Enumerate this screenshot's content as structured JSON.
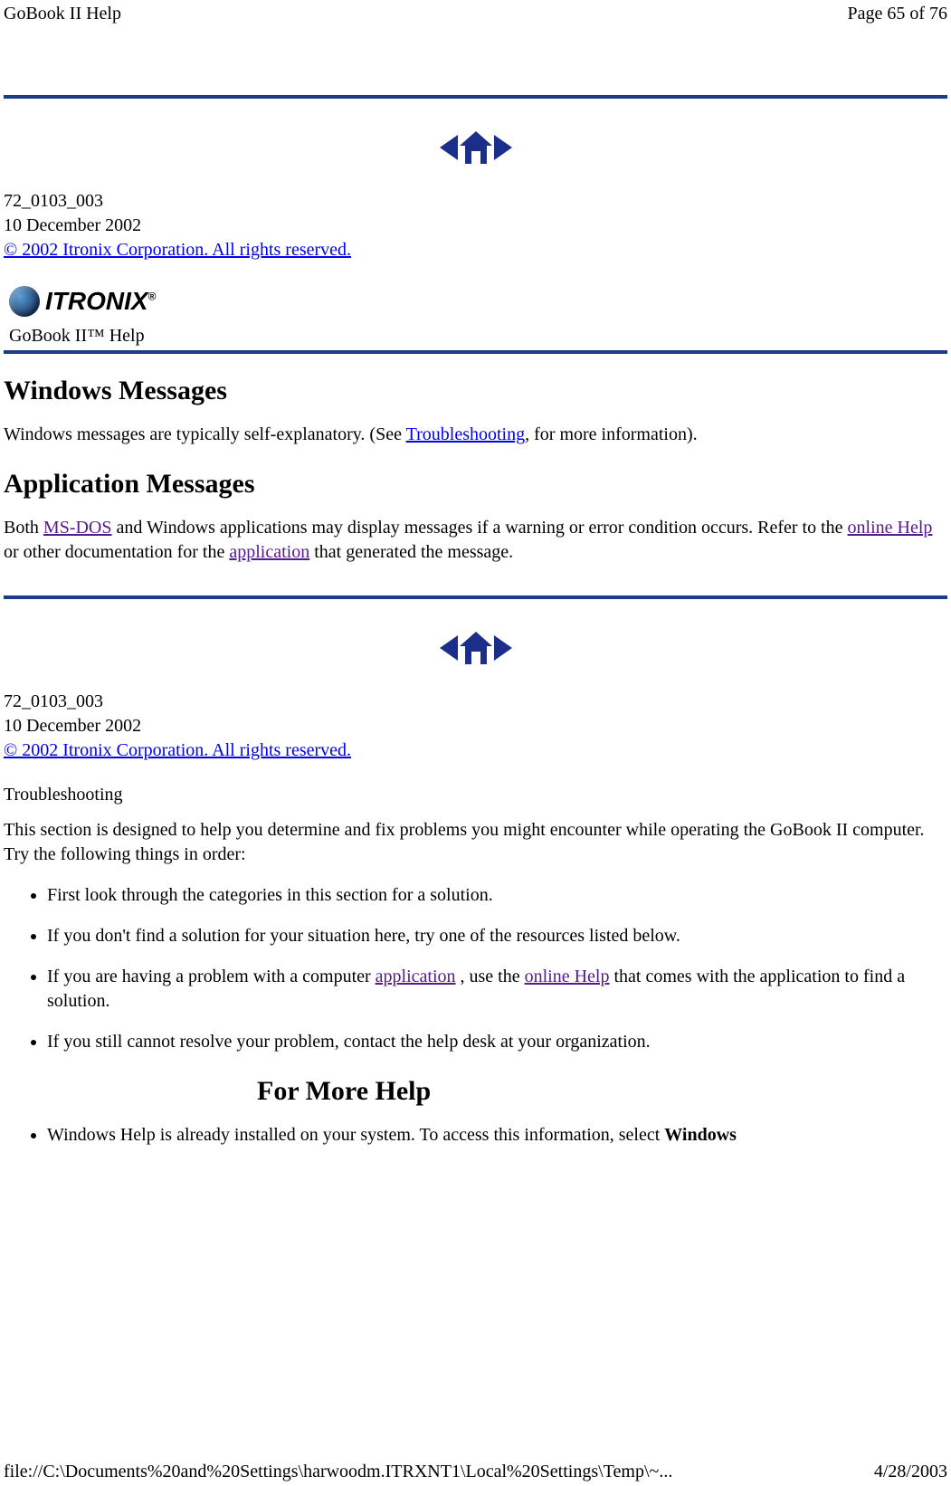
{
  "header": {
    "title_left": "GoBook II Help",
    "page_info": "Page 65 of 76"
  },
  "doc": {
    "doc_num": "72_0103_003",
    "doc_date": "10 December 2002",
    "copyright": "© 2002 Itronix Corporation.  All rights reserved."
  },
  "logo": {
    "brand": "ITRONIX",
    "reg": "®"
  },
  "subhead": "GoBook II™ Help",
  "sec1": {
    "h1": "Windows Messages",
    "p1_a": "Windows messages are typically self-explanatory. (See ",
    "p1_link": "Troubleshooting",
    "p1_b": ", for more information).",
    "h2": "Application Messages",
    "p2_a": "Both ",
    "p2_link1": "MS-DOS",
    "p2_b": " and Windows applications may display messages if a warning or error condition occurs. Refer to the ",
    "p2_link2": "online Help",
    "p2_c": " or other documentation for the ",
    "p2_link3": "application",
    "p2_d": " that generated the message."
  },
  "sec2": {
    "h1": "Troubleshooting",
    "p1": "This section is designed to help you determine and fix problems you might encounter while operating the GoBook II computer. Try the following things in order:",
    "li1": "First look through the categories in this section for a solution.",
    "li2": "If you don't find a solution for your situation here, try one of the resources listed below.",
    "li3_a": "If you are having a problem with a computer ",
    "li3_link1": "application",
    "li3_b": " , use the ",
    "li3_link2": "online Help",
    "li3_c": " that comes with the application to find a solution.",
    "li4": "If you still cannot resolve your problem, contact the help desk at your organization.",
    "h2": "For More Help",
    "li5_a": "Windows Help is already installed on your system.  To access this information, select ",
    "li5_bold": "Windows"
  },
  "footer": {
    "path": "file://C:\\Documents%20and%20Settings\\harwoodm.ITRXNT1\\Local%20Settings\\Temp\\~...",
    "date": "4/28/2003"
  }
}
